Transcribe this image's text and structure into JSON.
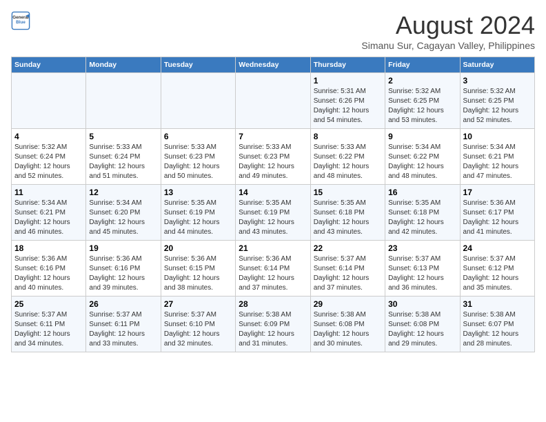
{
  "logo": {
    "line1": "General",
    "line2": "Blue"
  },
  "title": "August 2024",
  "subtitle": "Simanu Sur, Cagayan Valley, Philippines",
  "days_of_week": [
    "Sunday",
    "Monday",
    "Tuesday",
    "Wednesday",
    "Thursday",
    "Friday",
    "Saturday"
  ],
  "weeks": [
    [
      {
        "day": "",
        "info": ""
      },
      {
        "day": "",
        "info": ""
      },
      {
        "day": "",
        "info": ""
      },
      {
        "day": "",
        "info": ""
      },
      {
        "day": "1",
        "info": "Sunrise: 5:31 AM\nSunset: 6:26 PM\nDaylight: 12 hours\nand 54 minutes."
      },
      {
        "day": "2",
        "info": "Sunrise: 5:32 AM\nSunset: 6:25 PM\nDaylight: 12 hours\nand 53 minutes."
      },
      {
        "day": "3",
        "info": "Sunrise: 5:32 AM\nSunset: 6:25 PM\nDaylight: 12 hours\nand 52 minutes."
      }
    ],
    [
      {
        "day": "4",
        "info": "Sunrise: 5:32 AM\nSunset: 6:24 PM\nDaylight: 12 hours\nand 52 minutes."
      },
      {
        "day": "5",
        "info": "Sunrise: 5:33 AM\nSunset: 6:24 PM\nDaylight: 12 hours\nand 51 minutes."
      },
      {
        "day": "6",
        "info": "Sunrise: 5:33 AM\nSunset: 6:23 PM\nDaylight: 12 hours\nand 50 minutes."
      },
      {
        "day": "7",
        "info": "Sunrise: 5:33 AM\nSunset: 6:23 PM\nDaylight: 12 hours\nand 49 minutes."
      },
      {
        "day": "8",
        "info": "Sunrise: 5:33 AM\nSunset: 6:22 PM\nDaylight: 12 hours\nand 48 minutes."
      },
      {
        "day": "9",
        "info": "Sunrise: 5:34 AM\nSunset: 6:22 PM\nDaylight: 12 hours\nand 48 minutes."
      },
      {
        "day": "10",
        "info": "Sunrise: 5:34 AM\nSunset: 6:21 PM\nDaylight: 12 hours\nand 47 minutes."
      }
    ],
    [
      {
        "day": "11",
        "info": "Sunrise: 5:34 AM\nSunset: 6:21 PM\nDaylight: 12 hours\nand 46 minutes."
      },
      {
        "day": "12",
        "info": "Sunrise: 5:34 AM\nSunset: 6:20 PM\nDaylight: 12 hours\nand 45 minutes."
      },
      {
        "day": "13",
        "info": "Sunrise: 5:35 AM\nSunset: 6:19 PM\nDaylight: 12 hours\nand 44 minutes."
      },
      {
        "day": "14",
        "info": "Sunrise: 5:35 AM\nSunset: 6:19 PM\nDaylight: 12 hours\nand 43 minutes."
      },
      {
        "day": "15",
        "info": "Sunrise: 5:35 AM\nSunset: 6:18 PM\nDaylight: 12 hours\nand 43 minutes."
      },
      {
        "day": "16",
        "info": "Sunrise: 5:35 AM\nSunset: 6:18 PM\nDaylight: 12 hours\nand 42 minutes."
      },
      {
        "day": "17",
        "info": "Sunrise: 5:36 AM\nSunset: 6:17 PM\nDaylight: 12 hours\nand 41 minutes."
      }
    ],
    [
      {
        "day": "18",
        "info": "Sunrise: 5:36 AM\nSunset: 6:16 PM\nDaylight: 12 hours\nand 40 minutes."
      },
      {
        "day": "19",
        "info": "Sunrise: 5:36 AM\nSunset: 6:16 PM\nDaylight: 12 hours\nand 39 minutes."
      },
      {
        "day": "20",
        "info": "Sunrise: 5:36 AM\nSunset: 6:15 PM\nDaylight: 12 hours\nand 38 minutes."
      },
      {
        "day": "21",
        "info": "Sunrise: 5:36 AM\nSunset: 6:14 PM\nDaylight: 12 hours\nand 37 minutes."
      },
      {
        "day": "22",
        "info": "Sunrise: 5:37 AM\nSunset: 6:14 PM\nDaylight: 12 hours\nand 37 minutes."
      },
      {
        "day": "23",
        "info": "Sunrise: 5:37 AM\nSunset: 6:13 PM\nDaylight: 12 hours\nand 36 minutes."
      },
      {
        "day": "24",
        "info": "Sunrise: 5:37 AM\nSunset: 6:12 PM\nDaylight: 12 hours\nand 35 minutes."
      }
    ],
    [
      {
        "day": "25",
        "info": "Sunrise: 5:37 AM\nSunset: 6:11 PM\nDaylight: 12 hours\nand 34 minutes."
      },
      {
        "day": "26",
        "info": "Sunrise: 5:37 AM\nSunset: 6:11 PM\nDaylight: 12 hours\nand 33 minutes."
      },
      {
        "day": "27",
        "info": "Sunrise: 5:37 AM\nSunset: 6:10 PM\nDaylight: 12 hours\nand 32 minutes."
      },
      {
        "day": "28",
        "info": "Sunrise: 5:38 AM\nSunset: 6:09 PM\nDaylight: 12 hours\nand 31 minutes."
      },
      {
        "day": "29",
        "info": "Sunrise: 5:38 AM\nSunset: 6:08 PM\nDaylight: 12 hours\nand 30 minutes."
      },
      {
        "day": "30",
        "info": "Sunrise: 5:38 AM\nSunset: 6:08 PM\nDaylight: 12 hours\nand 29 minutes."
      },
      {
        "day": "31",
        "info": "Sunrise: 5:38 AM\nSunset: 6:07 PM\nDaylight: 12 hours\nand 28 minutes."
      }
    ]
  ]
}
